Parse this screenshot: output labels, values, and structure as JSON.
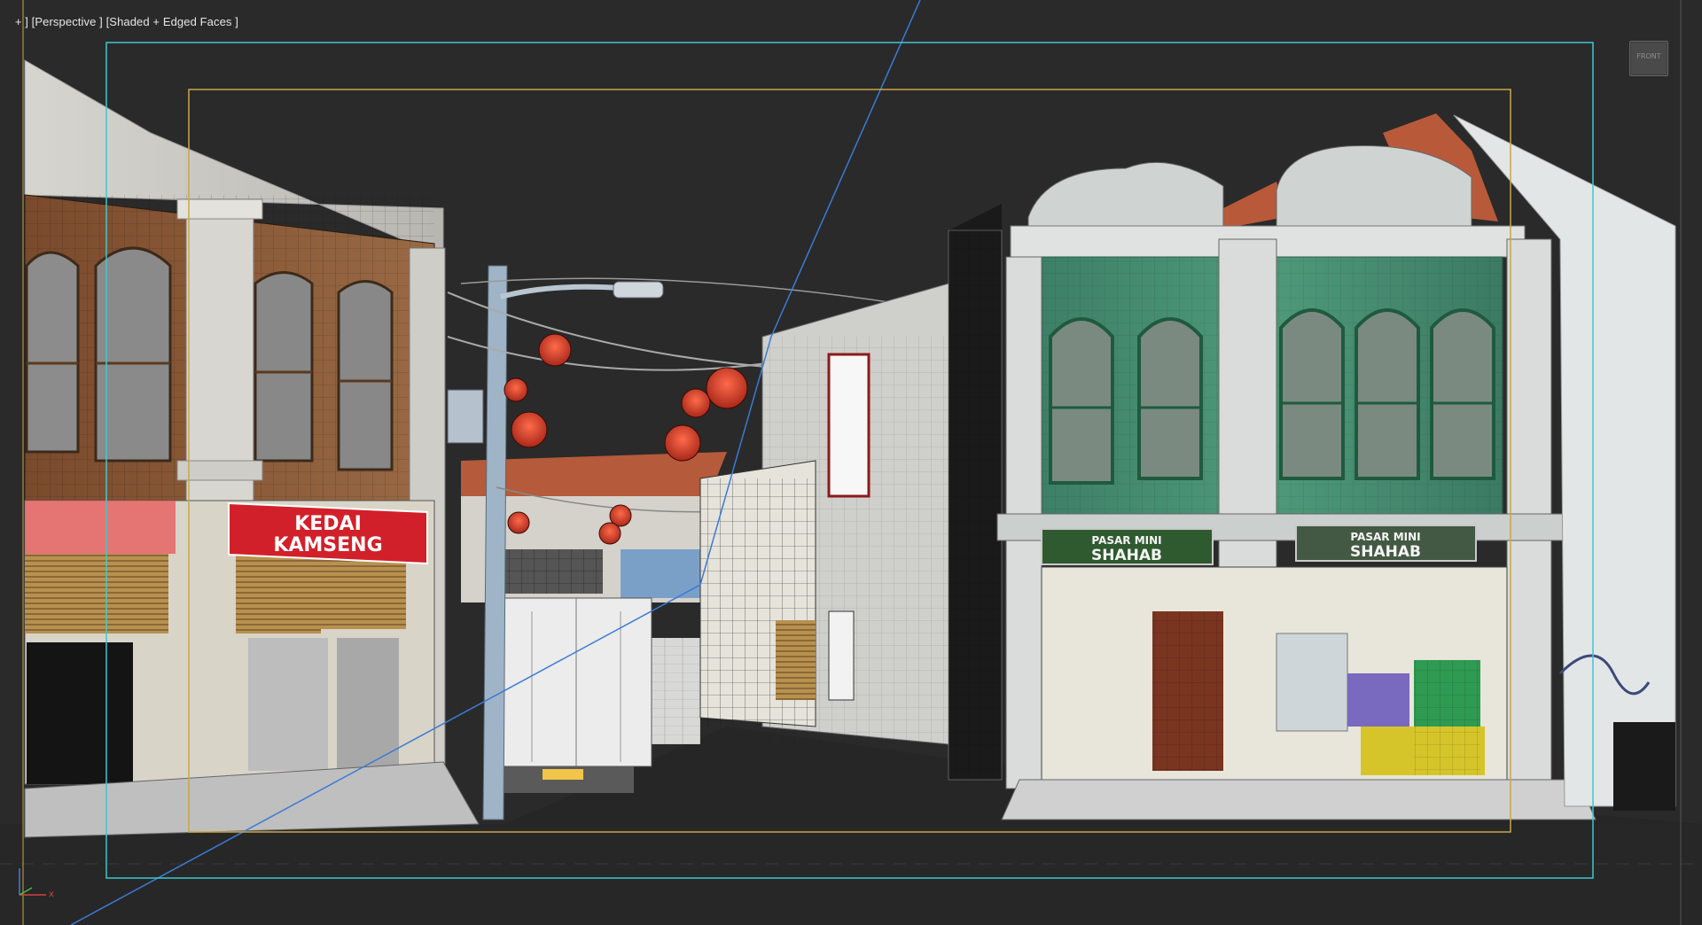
{
  "viewport": {
    "label_prefix": "+ ] [",
    "view_name": "Perspective",
    "label_mid": " ] [",
    "shading_mode": "Shaded + Edged Faces",
    "label_suffix": " ]",
    "viewcube_face": "FRONT"
  },
  "scene": {
    "signs": {
      "kedai_line1": "KEDAI",
      "kedai_line2": "KAMSENG",
      "pasar_left_line1": "PASAR MINI",
      "pasar_left_line2": "SHAHAB",
      "pasar_right_line1": "PASAR MINI",
      "pasar_right_line2": "SHAHAB"
    }
  },
  "colors": {
    "background": "#2a2a2a",
    "safe_frame_outer": "#3fc7cf",
    "safe_frame_inner": "#c9a64a",
    "green_facade": "#3f8a6e",
    "brown_facade": "#8a5a3a",
    "kedai_sign": "#d2202a"
  }
}
